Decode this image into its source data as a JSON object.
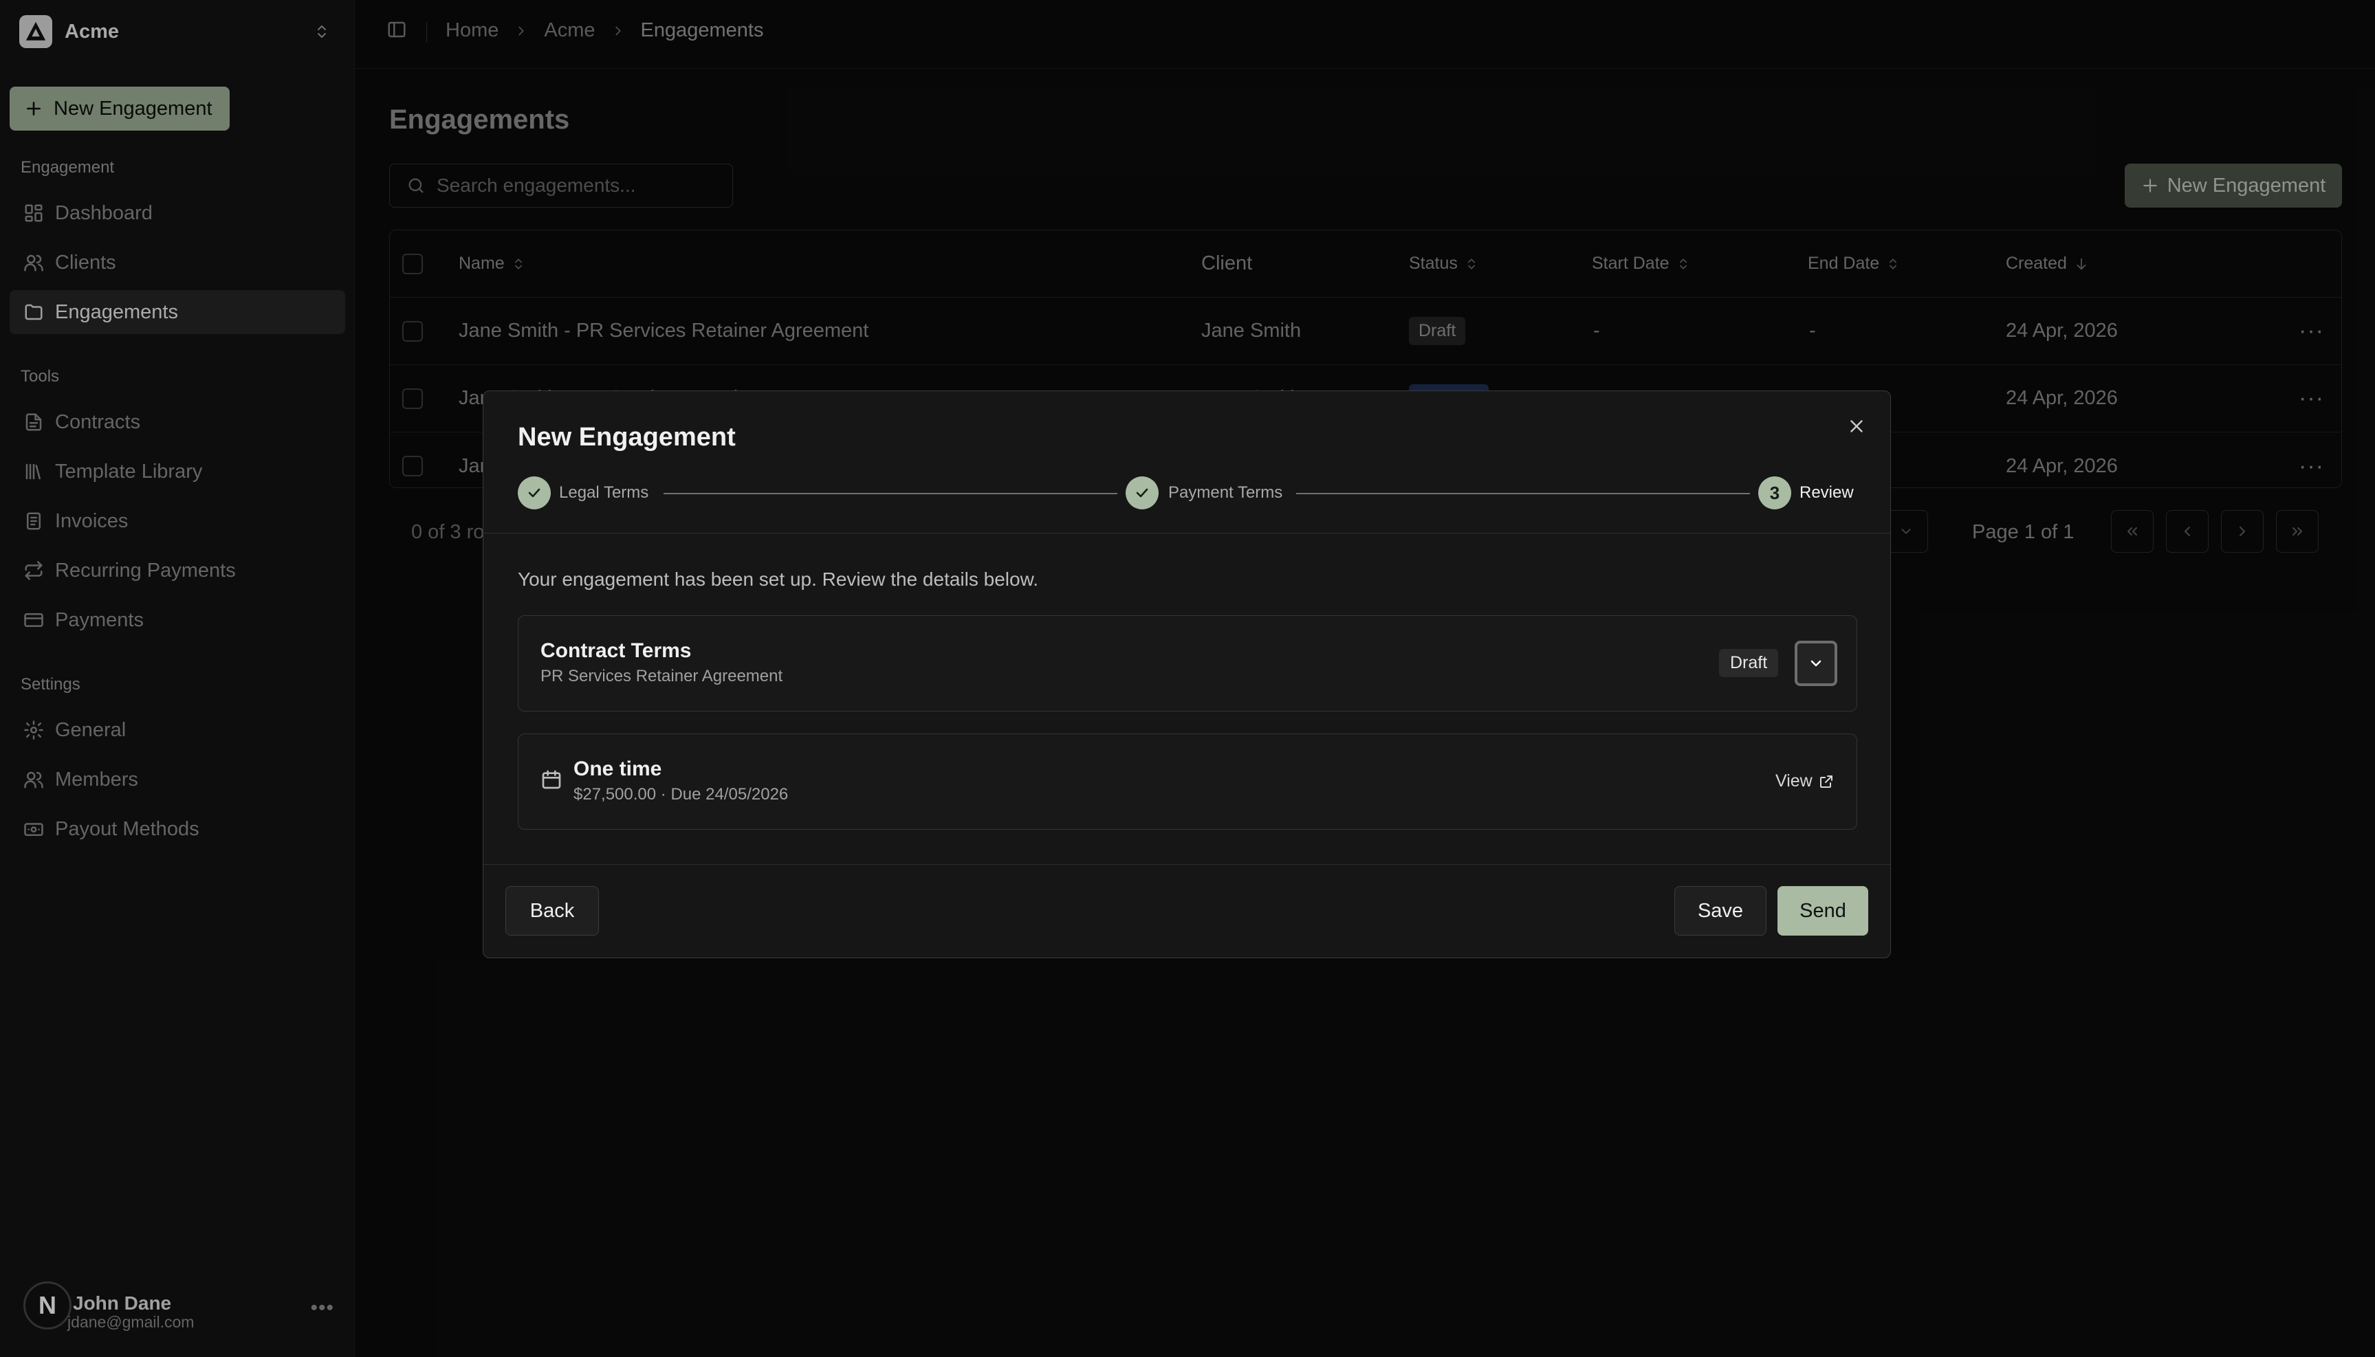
{
  "team": {
    "name": "Acme"
  },
  "sidebar": {
    "new_button": "New Engagement",
    "groups": {
      "engagement": "Engagement",
      "tools": "Tools",
      "settings": "Settings"
    },
    "items": [
      {
        "label": "Dashboard",
        "icon": "dashboard-icon"
      },
      {
        "label": "Clients",
        "icon": "users-icon"
      },
      {
        "label": "Engagements",
        "icon": "folder-icon",
        "active": true
      },
      {
        "label": "Contracts",
        "icon": "document-icon"
      },
      {
        "label": "Template Library",
        "icon": "library-icon"
      },
      {
        "label": "Invoices",
        "icon": "invoice-icon"
      },
      {
        "label": "Recurring Payments",
        "icon": "repeat-icon"
      },
      {
        "label": "Payments",
        "icon": "credit-card-icon"
      },
      {
        "label": "General",
        "icon": "gear-icon"
      },
      {
        "label": "Members",
        "icon": "users-icon"
      },
      {
        "label": "Payout Methods",
        "icon": "wallet-icon"
      }
    ],
    "user": {
      "initial": "N",
      "name": "John Dane",
      "email": "jdane@gmail.com"
    }
  },
  "breadcrumb": [
    "Home",
    "Acme",
    "Engagements"
  ],
  "page": {
    "title": "Engagements",
    "search_placeholder": "Search engagements...",
    "new_button": "New Engagement"
  },
  "table": {
    "columns": [
      "Name",
      "Client",
      "Status",
      "Start Date",
      "End Date",
      "Created"
    ],
    "rows": [
      {
        "name": "Jane Smith - PR Services Retainer Agreement",
        "client": "Jane Smith",
        "status": "Draft",
        "start": "-",
        "end": "-",
        "created": "24 Apr, 2026"
      },
      {
        "name": "Jane Smith - PR Services Retainer Agreement",
        "client": "Jane Smith",
        "status": "Initiated",
        "start": "-",
        "end": "-",
        "created": "24 Apr, 2026"
      },
      {
        "name": "Jan",
        "client": "",
        "status": "",
        "start": "",
        "end": "",
        "created": "24 Apr, 2026"
      }
    ],
    "rows_info": "0 of 3 ro",
    "page_info": "Page 1 of 1"
  },
  "modal": {
    "title": "New Engagement",
    "steps": [
      {
        "label": "Legal Terms",
        "state": "done"
      },
      {
        "label": "Payment Terms",
        "state": "done"
      },
      {
        "label": "Review",
        "state": "current",
        "number": "3"
      }
    ],
    "intro": "Your engagement has been set up. Review the details below.",
    "contract": {
      "title": "Contract Terms",
      "subtitle": "PR Services Retainer Agreement",
      "badge": "Draft"
    },
    "payment": {
      "title": "One time",
      "subtitle": "$27,500.00 · Due 24/05/2026",
      "view_label": "View"
    },
    "buttons": {
      "back": "Back",
      "save": "Save",
      "send": "Send"
    }
  },
  "colors": {
    "accent": "#a9bba3",
    "background": "#0b0b0b",
    "sidebar": "#121212",
    "modal": "#161616"
  }
}
